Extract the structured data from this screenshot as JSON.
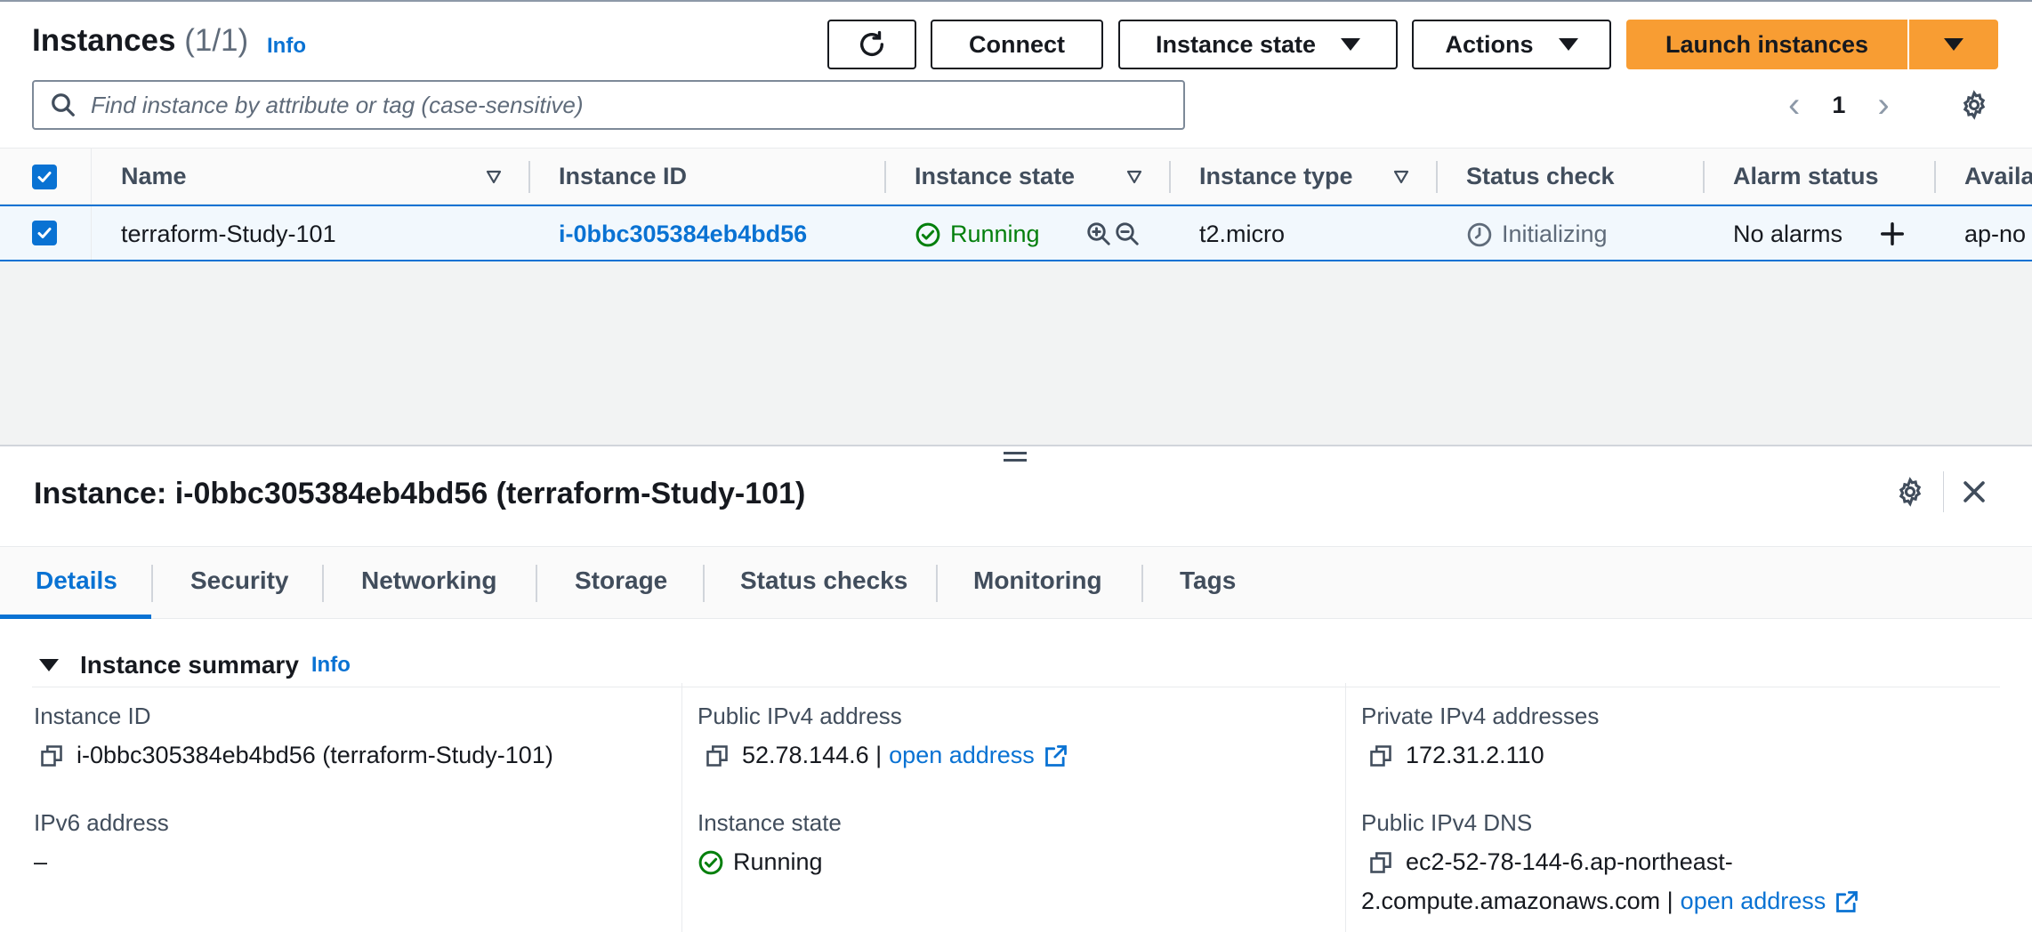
{
  "header": {
    "title": "Instances",
    "count": "(1/1)",
    "info": "Info",
    "buttons": {
      "connect": "Connect",
      "instance_state": "Instance state",
      "actions": "Actions",
      "launch": "Launch instances"
    }
  },
  "search": {
    "placeholder": "Find instance by attribute or tag (case-sensitive)"
  },
  "pagination": {
    "page": "1"
  },
  "table": {
    "columns": [
      "Name",
      "Instance ID",
      "Instance state",
      "Instance type",
      "Status check",
      "Alarm status",
      "Availa"
    ],
    "row": {
      "name": "terraform-Study-101",
      "instance_id": "i-0bbc305384eb4bd56",
      "state": "Running",
      "type": "t2.micro",
      "status_check": "Initializing",
      "alarm_status": "No alarms",
      "availability_zone": "ap-no"
    }
  },
  "details": {
    "title": "Instance: i-0bbc305384eb4bd56 (terraform-Study-101)",
    "tabs": [
      "Details",
      "Security",
      "Networking",
      "Storage",
      "Status checks",
      "Monitoring",
      "Tags"
    ],
    "summary": {
      "heading": "Instance summary",
      "info": "Info",
      "instance_id_label": "Instance ID",
      "instance_id_value": "i-0bbc305384eb4bd56 (terraform-Study-101)",
      "public_ipv4_label": "Public IPv4 address",
      "public_ipv4_value": "52.78.144.6 |",
      "open_address": "open address",
      "private_ipv4_label": "Private IPv4 addresses",
      "private_ipv4_value": "172.31.2.110",
      "ipv6_label": "IPv6 address",
      "ipv6_value": "–",
      "instance_state_label": "Instance state",
      "instance_state_value": "Running",
      "public_dns_label": "Public IPv4 DNS",
      "public_dns_line1": "ec2-52-78-144-6.ap-northeast-",
      "public_dns_line2": "2.compute.amazonaws.com |",
      "public_dns_open": "open address"
    }
  },
  "colors": {
    "primary": "#f89d33",
    "link": "#0972d3",
    "success": "#037f0c"
  }
}
